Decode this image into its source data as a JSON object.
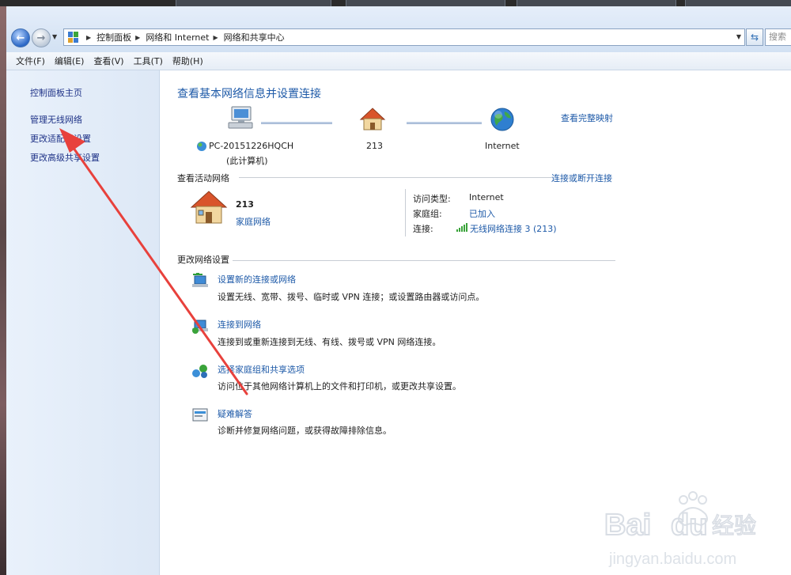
{
  "window": {
    "search_placeholder": "搜索"
  },
  "breadcrumb": [
    "控制面板",
    "网络和 Internet",
    "网络和共享中心"
  ],
  "menu": [
    "文件(F)",
    "编辑(E)",
    "查看(V)",
    "工具(T)",
    "帮助(H)"
  ],
  "sidebar": {
    "items": [
      {
        "label": "控制面板主页"
      },
      {
        "label": "管理无线网络"
      },
      {
        "label": "更改适配器设置"
      },
      {
        "label": "更改高级共享设置"
      }
    ]
  },
  "main": {
    "title": "查看基本网络信息并设置连接",
    "view_full_map": "查看完整映射",
    "map": {
      "computer_name": "PC-20151226HQCH",
      "computer_sub": "(此计算机)",
      "network_name": "213",
      "internet_label": "Internet"
    },
    "active": {
      "heading": "查看活动网络",
      "connect_link": "连接或断开连接",
      "network_name": "213",
      "network_type": "家庭网络",
      "access_type_label": "访问类型:",
      "access_type_value": "Internet",
      "homegroup_label": "家庭组:",
      "homegroup_value": "已加入",
      "connection_label": "连接:",
      "connection_value": "无线网络连接 3 (213)"
    },
    "change": {
      "heading": "更改网络设置",
      "tasks": [
        {
          "link": "设置新的连接或网络",
          "desc": "设置无线、宽带、拨号、临时或 VPN 连接；或设置路由器或访问点。",
          "icon": "new-connection-icon"
        },
        {
          "link": "连接到网络",
          "desc": "连接到或重新连接到无线、有线、拨号或 VPN 网络连接。",
          "icon": "connect-network-icon"
        },
        {
          "link": "选择家庭组和共享选项",
          "desc": "访问位于其他网络计算机上的文件和打印机，或更改共享设置。",
          "icon": "homegroup-icon"
        },
        {
          "link": "疑难解答",
          "desc": "诊断并修复网络问题，或获得故障排除信息。",
          "icon": "troubleshoot-icon"
        }
      ]
    }
  },
  "annotation": {
    "color": "#e8413c"
  },
  "watermark": {
    "logo": "Baidu 经验",
    "url": "jingyan.baidu.com"
  }
}
